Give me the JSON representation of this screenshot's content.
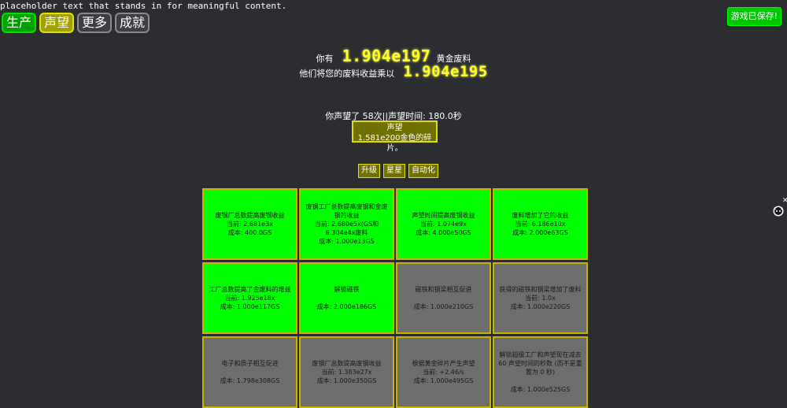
{
  "placeholder": "placeholder text that stands in for meaningful content.",
  "tabs": [
    {
      "label": "生产",
      "style": "green"
    },
    {
      "label": "声望",
      "style": "yellow"
    },
    {
      "label": "更多",
      "style": "plain"
    },
    {
      "label": "成就",
      "style": "plain"
    }
  ],
  "save_button": "游戏已保存!",
  "scrap": {
    "prefix": "你有",
    "amount": "1.904e197",
    "unit": "黄金废料",
    "mult_prefix": "他们将您的废料收益乘以",
    "multiplier": "1.904e195"
  },
  "prestige": {
    "count_text": "你声望了 58次||声望时间: 180.0秒",
    "button_title": "声望",
    "button_reward": "1.581e200金色的碎片。"
  },
  "subtabs": [
    "升级",
    "星星",
    "自动化"
  ],
  "upgrades": [
    {
      "state": "bought",
      "lines": [
        "废钢厂总数提高废钢收益",
        "当前: 2.681e3x",
        "成本: 400.0GS"
      ]
    },
    {
      "state": "bought",
      "lines": [
        "废钢工厂总数提高废钢和金废钢的收益",
        "当前: 2.680e5x(GS和 6.304e4x废料",
        "成本: 1.000e13GS"
      ]
    },
    {
      "state": "bought",
      "lines": [
        "声望时间提高废钢收益",
        "当前: 1.074e9x",
        "成本: 4.000e50GS"
      ]
    },
    {
      "state": "bought",
      "lines": [
        "废料增加了它的收益",
        "当前: 6.186e10x",
        "成本: 2.000e63GS"
      ]
    },
    {
      "state": "bought",
      "lines": [
        "工厂总数提高了金废料的增益",
        "当前: 1.925e18x",
        "成本: 1.000e117GS"
      ]
    },
    {
      "state": "bought",
      "lines": [
        "解锁磁铁",
        "",
        "成本: 2.000e186GS"
      ]
    },
    {
      "state": "locked",
      "lines": [
        "磁铁和钢梁相互促进",
        "",
        "成本: 1.000e210GS"
      ]
    },
    {
      "state": "locked",
      "lines": [
        "获得的磁铁和钢梁增加了废料",
        "当前: 1.0x",
        "成本: 1.000e220GS"
      ]
    },
    {
      "state": "locked",
      "lines": [
        "电子和质子相互促进",
        "",
        "成本: 1.798e308GS"
      ]
    },
    {
      "state": "locked",
      "lines": [
        "废钢厂总数提高废钢收益",
        "当前: 1.383e27x",
        "成本: 1.000e350GS"
      ]
    },
    {
      "state": "locked",
      "lines": [
        "根据黄金碎片产生声望",
        "当前: +2.46/s",
        "成本: 1.000e495GS"
      ]
    },
    {
      "state": "locked",
      "lines": [
        "解锁超级工厂和声望现在减去 60 声望时间的秒数 (而不是重置为 0 秒)",
        "",
        "成本: 1.000e525GS"
      ]
    }
  ]
}
